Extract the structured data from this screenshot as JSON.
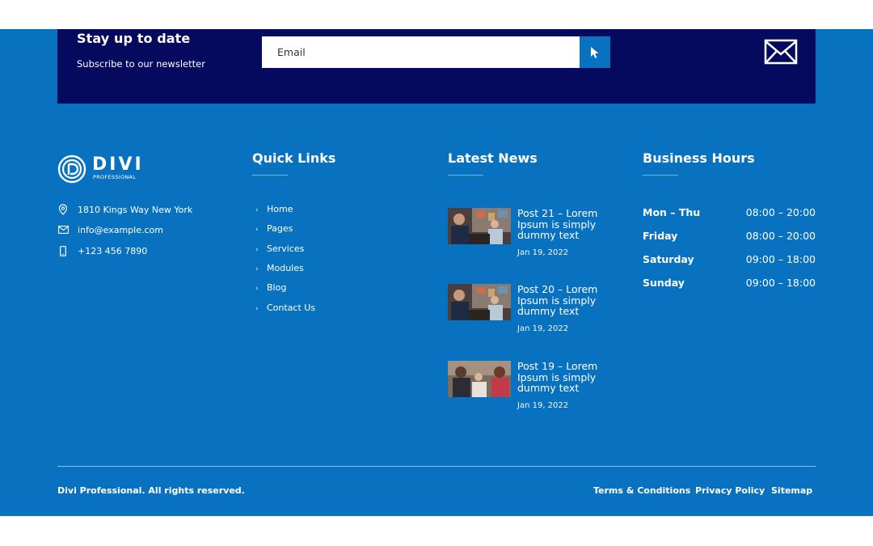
{
  "newsletter": {
    "title": "Stay up to date",
    "subtitle": "Subscribe to our newsletter",
    "email_placeholder": "Email",
    "submit_icon": "cursor-arrow-icon",
    "decor_icon": "envelope-icon"
  },
  "brand": {
    "name": "DIVI",
    "tagline": "PROFESSIONAL"
  },
  "contact": {
    "address": "1810 Kings Way New York",
    "email": "info@example.com",
    "phone": "+123 456 7890"
  },
  "quick_links": {
    "title": "Quick Links",
    "items": [
      "Home",
      "Pages",
      "Services",
      "Modules",
      "Blog",
      "Contact Us"
    ]
  },
  "latest_news": {
    "title": "Latest News",
    "items": [
      {
        "title": "Post 21 – Lorem Ipsum is simply dummy text",
        "date": "Jan 19, 2022"
      },
      {
        "title": "Post 20 – Lorem Ipsum is simply dummy text",
        "date": "Jan 19, 2022"
      },
      {
        "title": "Post 19 – Lorem Ipsum is simply dummy text",
        "date": "Jan 19, 2022"
      }
    ]
  },
  "business_hours": {
    "title": "Business Hours",
    "rows": [
      {
        "day": "Mon – Thu",
        "time": "08:00 – 20:00"
      },
      {
        "day": "Friday",
        "time": "08:00 – 20:00"
      },
      {
        "day": "Saturday",
        "time": "09:00 – 18:00"
      },
      {
        "day": "Sunday",
        "time": "09:00 – 18:00"
      }
    ]
  },
  "bottom_bar": {
    "copyright": "Divi Professional. All rights reserved.",
    "links": [
      "Terms & Conditions",
      "Privacy Policy",
      "Sitemap"
    ]
  },
  "colors": {
    "footer_bg": "#0872c0",
    "newsletter_bg": "#050a5e",
    "text": "#ffffff"
  }
}
